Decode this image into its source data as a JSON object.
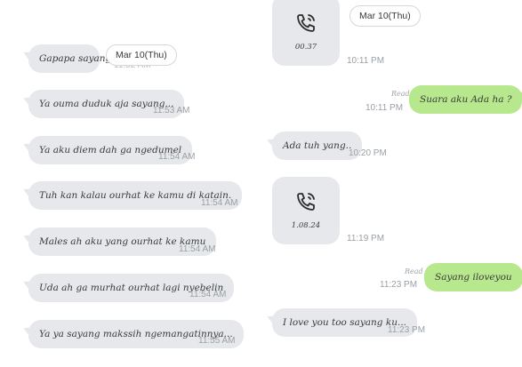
{
  "left": {
    "date_label": "Mar 10(Thu)",
    "hidden_time": "11:52 AM",
    "messages": [
      {
        "text": "Gapapa sayang..",
        "time": ""
      },
      {
        "text": "Ya ouma duduk aja sayang...",
        "time": "11:53 AM"
      },
      {
        "text": "Ya aku diem dah ga ngedumel",
        "time": "11:54 AM"
      },
      {
        "text": "Tuh kan kalau ourhat ke kamu di katain.",
        "time": "11:54 AM"
      },
      {
        "text": "Males ah aku yang ourhat ke kamu",
        "time": "11:54 AM"
      },
      {
        "text": "Uda ah ga murhat ourhat lagi nyebelin",
        "time": "11:54 AM"
      },
      {
        "text": "Ya ya sayang makssih ngemangatinnya...",
        "time": "11:55 AM"
      }
    ]
  },
  "right": {
    "date_label": "Mar 10(Thu)",
    "call1": {
      "duration": "00.37",
      "time": "10:11 PM"
    },
    "msg_out_1": {
      "read": "Read",
      "time": "10:11 PM",
      "text": "Suara aku Ada ha ?"
    },
    "msg_in_1": {
      "text": "Ada tuh yang..",
      "time": "10:20 PM"
    },
    "call2": {
      "duration": "1.08.24",
      "time": "11:19 PM"
    },
    "msg_out_2": {
      "read": "Read",
      "time": "11:23 PM",
      "text": "Sayang iloveyou"
    },
    "msg_in_2": {
      "text": "I love you too sayang ku...",
      "time": "11:23 PM"
    }
  },
  "colors": {
    "incoming_bubble": "#e6e8eb",
    "outgoing_bubble": "#b7e88d",
    "timestamp": "#9aa0a6"
  },
  "icons": {
    "call": "phone-call-icon"
  }
}
